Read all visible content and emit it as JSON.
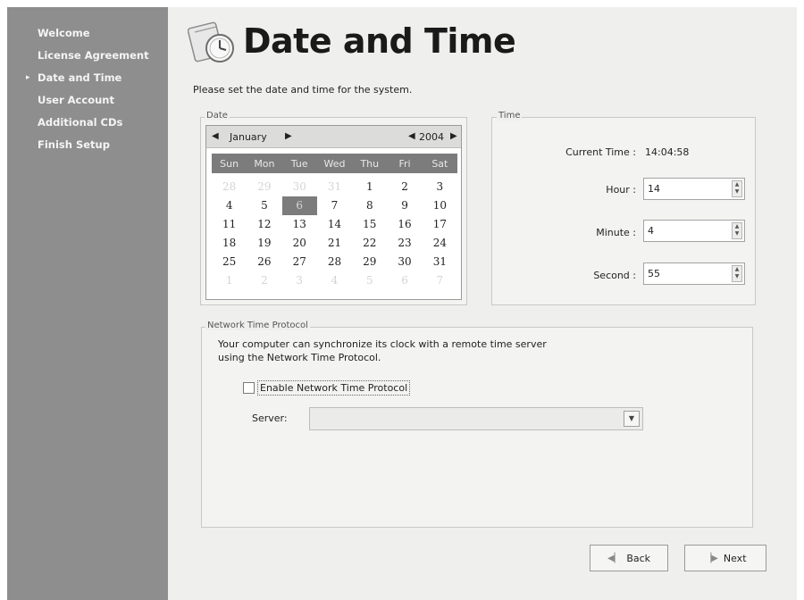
{
  "sidebar": {
    "items": [
      {
        "label": "Welcome",
        "current": false
      },
      {
        "label": "License Agreement",
        "current": false
      },
      {
        "label": "Date and Time",
        "current": true
      },
      {
        "label": "User Account",
        "current": false
      },
      {
        "label": "Additional CDs",
        "current": false
      },
      {
        "label": "Finish Setup",
        "current": false
      }
    ],
    "current_marker": "▸"
  },
  "header": {
    "title": "Date and Time",
    "subtitle": "Please set the date and time for the system.",
    "icon": "date-time-clock-icon"
  },
  "date": {
    "group_label": "Date",
    "month": "January",
    "year": "2004",
    "day_headers": [
      "Sun",
      "Mon",
      "Tue",
      "Wed",
      "Thu",
      "Fri",
      "Sat"
    ],
    "weeks": [
      [
        "28",
        "29",
        "30",
        "31",
        "1",
        "2",
        "3"
      ],
      [
        "4",
        "5",
        "6",
        "7",
        "8",
        "9",
        "10"
      ],
      [
        "11",
        "12",
        "13",
        "14",
        "15",
        "16",
        "17"
      ],
      [
        "18",
        "19",
        "20",
        "21",
        "22",
        "23",
        "24"
      ],
      [
        "25",
        "26",
        "27",
        "28",
        "29",
        "30",
        "31"
      ],
      [
        "1",
        "2",
        "3",
        "4",
        "5",
        "6",
        "7"
      ]
    ],
    "muted_cells": [
      "0-0",
      "0-1",
      "0-2",
      "0-3",
      "5-0",
      "5-1",
      "5-2",
      "5-3",
      "5-4",
      "5-5",
      "5-6"
    ],
    "selected_day": "6"
  },
  "time": {
    "group_label": "Time",
    "current_time_label": "Current Time :",
    "current_time_value": "14:04:58",
    "hour_label": "Hour :",
    "hour_value": "14",
    "minute_label": "Minute :",
    "minute_value": "4",
    "second_label": "Second :",
    "second_value": "55"
  },
  "ntp": {
    "group_label": "Network Time Protocol",
    "description_line1": "Your computer can synchronize its clock with a remote time server",
    "description_line2": "using the Network Time Protocol.",
    "enable_label": "Enable Network Time Protocol",
    "enabled": false,
    "server_label": "Server:",
    "server_value": ""
  },
  "buttons": {
    "back_label": "Back",
    "next_label": "Next"
  },
  "colors": {
    "sidebar_bg": "#8e8e8e",
    "sidebar_text": "#f4f4f4",
    "window_bg": "#efefed",
    "calendar_header_bar": "#7c7c7c"
  }
}
